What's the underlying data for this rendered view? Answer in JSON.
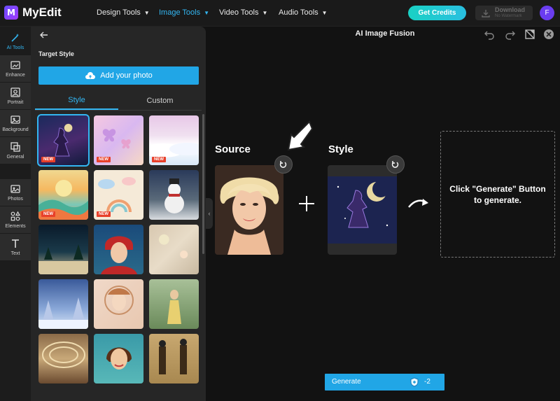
{
  "app": {
    "name": "MyEdit",
    "logo_letter": "M"
  },
  "nav": {
    "menus": [
      {
        "label": "Design Tools",
        "active": false
      },
      {
        "label": "Image Tools",
        "active": true
      },
      {
        "label": "Video Tools",
        "active": false
      },
      {
        "label": "Audio Tools",
        "active": false
      }
    ],
    "get_credits": "Get Credits",
    "download": {
      "label": "Download",
      "sub": "No Watermark"
    },
    "avatar_initial": "F"
  },
  "rail": {
    "items": [
      {
        "label": "AI Tools",
        "icon": "magic-wand-icon",
        "active": true
      },
      {
        "label": "Enhance",
        "icon": "enhance-icon",
        "active": false
      },
      {
        "label": "Portrait",
        "icon": "portrait-icon",
        "active": false
      },
      {
        "label": "Background",
        "icon": "background-icon",
        "active": false
      },
      {
        "label": "General",
        "icon": "general-icon",
        "active": false
      },
      {
        "label": "Photos",
        "icon": "photos-icon",
        "active": false
      },
      {
        "label": "Elements",
        "icon": "elements-icon",
        "active": false
      },
      {
        "label": "Text",
        "icon": "text-icon",
        "active": false
      }
    ]
  },
  "panel": {
    "title": "Target Style",
    "add_photo": "Add your photo",
    "tabs": [
      {
        "label": "Style",
        "active": true
      },
      {
        "label": "Custom",
        "active": false
      }
    ],
    "new_badge": "NEW",
    "styles": [
      {
        "name": "moon-goddess-style",
        "new": true,
        "selected": true
      },
      {
        "name": "pastel-butterflies-style",
        "new": true,
        "selected": false
      },
      {
        "name": "snowy-landscape-style",
        "new": true,
        "selected": false
      },
      {
        "name": "retro-hills-style",
        "new": true,
        "selected": false
      },
      {
        "name": "cute-clouds-style",
        "new": true,
        "selected": false
      },
      {
        "name": "snowman-style",
        "new": false,
        "selected": false
      },
      {
        "name": "winter-night-style",
        "new": false,
        "selected": false
      },
      {
        "name": "winter-girl-portrait-style",
        "new": false,
        "selected": false
      },
      {
        "name": "bokeh-lights-style",
        "new": false,
        "selected": false
      },
      {
        "name": "snowy-forest-style",
        "new": false,
        "selected": false
      },
      {
        "name": "art-nouveau-style",
        "new": false,
        "selected": false
      },
      {
        "name": "vintage-painting-style",
        "new": false,
        "selected": false
      },
      {
        "name": "classical-interior-style",
        "new": false,
        "selected": false
      },
      {
        "name": "retro-woman-portrait-style",
        "new": false,
        "selected": false
      },
      {
        "name": "egyptian-art-style",
        "new": false,
        "selected": false
      }
    ]
  },
  "canvas": {
    "title": "AI Image Fusion",
    "source_label": "Source",
    "style_label": "Style",
    "result_text": "Click \"Generate\" Button to generate.",
    "generate": {
      "label": "Generate",
      "cost": "-2"
    }
  },
  "colors": {
    "accent": "#21a6e6",
    "active": "#33b6f2",
    "new_badge": "#e8402a",
    "avatar": "#6a3df0"
  }
}
